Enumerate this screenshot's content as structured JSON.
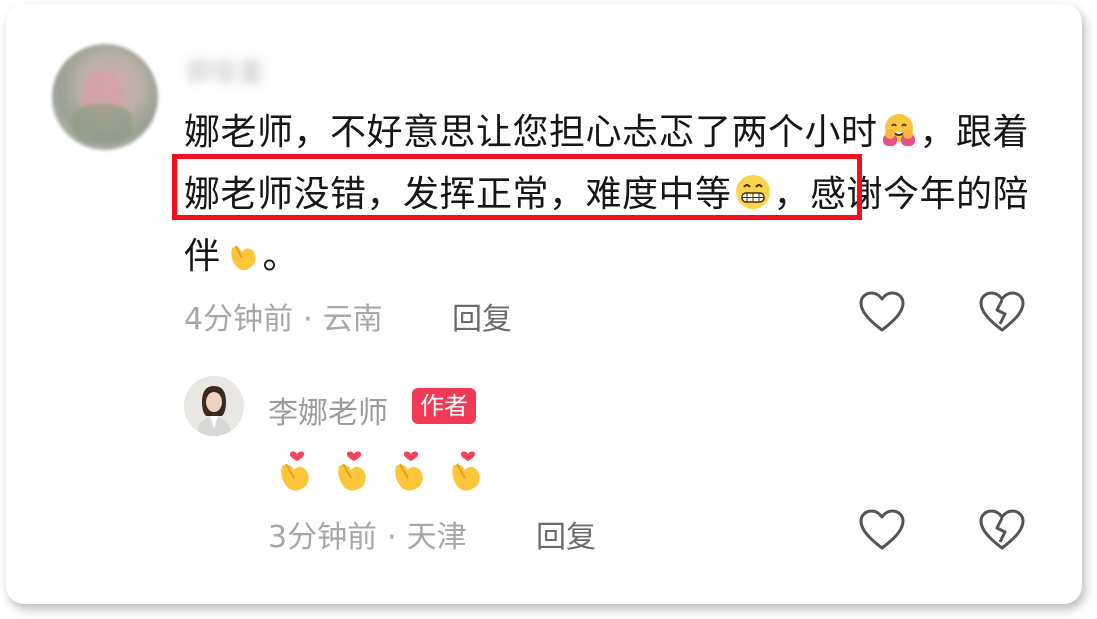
{
  "comment": {
    "username": "郭俊富",
    "text_before": "娜老师，不好意思让您担心忐忑了两个小时",
    "text_after_hug": "，跟",
    "highlight_text": "着娜老师没错，发挥正常，难度中等",
    "highlight_comma": "，",
    "text_end": "感谢今年的陪伴",
    "text_period": "。",
    "time": "4分钟前",
    "location": "云南",
    "separator": "·",
    "reply_label": "回复"
  },
  "reply": {
    "author_name": "李娜老师",
    "author_badge": "作者",
    "time": "3分钟前",
    "location": "天津",
    "separator": "·",
    "reply_label": "回复"
  },
  "icons": {
    "like": "heart-outline-icon",
    "dislike": "broken-heart-icon",
    "hug_emoji": "hugging-face-emoji",
    "grin_emoji": "grinning-face-emoji",
    "finger_heart_emoji": "finger-heart-emoji"
  },
  "colors": {
    "highlight_border": "#f40d1d",
    "badge_bg": "#f03a55",
    "meta_text": "#a7a7a7"
  }
}
